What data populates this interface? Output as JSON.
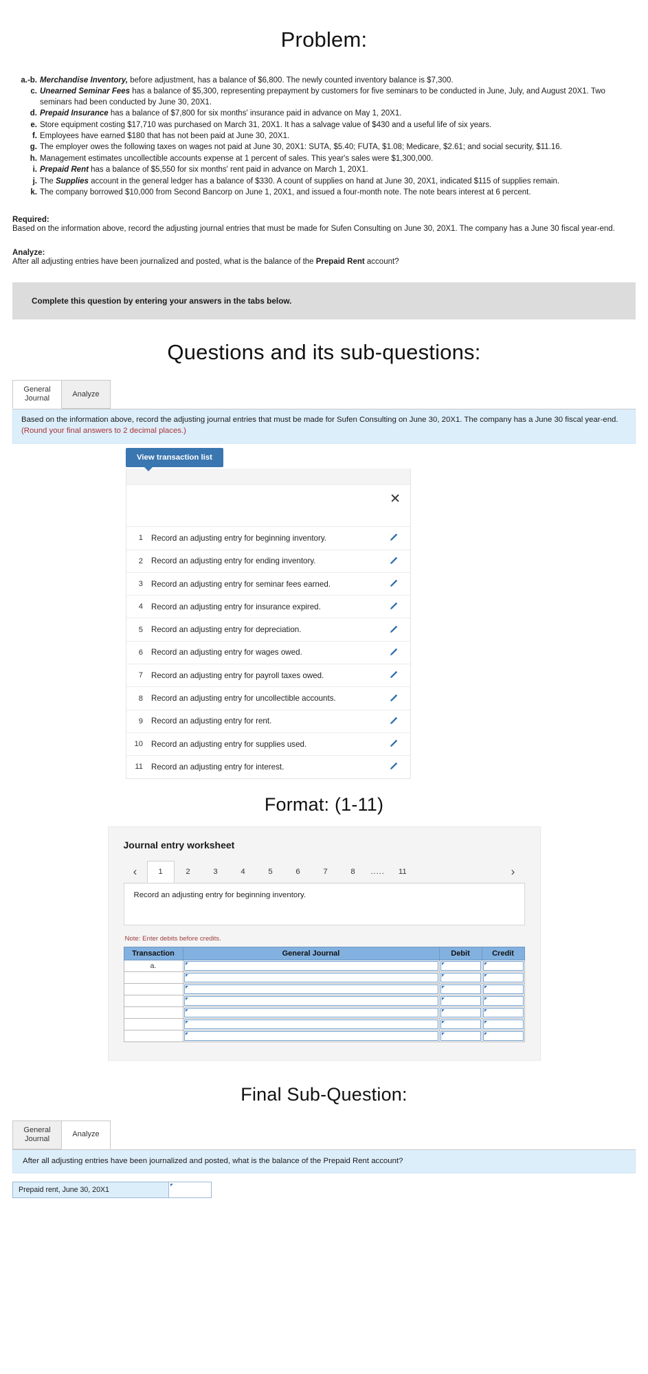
{
  "headings": {
    "problem": "Problem:",
    "questions": "Questions and its sub-questions:",
    "format": "Format:  (1-11)",
    "final": "Final Sub-Question:"
  },
  "problem": {
    "items": [
      {
        "label": "a.-b.",
        "term": "Merchandise Inventory,",
        "text": " before adjustment, has a balance of $6,800. The newly counted inventory balance is $7,300."
      },
      {
        "label": "c.",
        "term": "Unearned Seminar Fees",
        "text": " has a balance of $5,300, representing prepayment by customers for five seminars to be conducted in June, July, and August 20X1. Two seminars had been conducted by June 30, 20X1."
      },
      {
        "label": "d.",
        "term": "Prepaid Insurance",
        "text": " has a balance of $7,800 for six months' insurance paid in advance on May 1, 20X1."
      },
      {
        "label": "e.",
        "term": "",
        "text": "Store equipment costing $17,710 was purchased on March 31, 20X1. It has a salvage value of $430 and a useful life of six years."
      },
      {
        "label": "f.",
        "term": "",
        "text": "Employees have earned $180 that has not been paid at June 30, 20X1."
      },
      {
        "label": "g.",
        "term": "",
        "text": "The employer owes the following taxes on wages not paid at June 30, 20X1: SUTA, $5.40; FUTA, $1.08; Medicare, $2.61; and social security, $11.16."
      },
      {
        "label": "h.",
        "term": "",
        "text": "Management estimates uncollectible accounts expense at 1 percent of sales. This year's sales were $1,300,000."
      },
      {
        "label": "i.",
        "term": "Prepaid Rent",
        "text": " has a balance of $5,550 for six months' rent paid in advance on March 1, 20X1."
      },
      {
        "label": "j.",
        "term": "Supplies",
        "prefix": "The ",
        "text": " account in the general ledger has a balance of $330. A count of supplies on hand at June 30, 20X1, indicated $115 of supplies remain."
      },
      {
        "label": "k.",
        "term": "",
        "text": "The company borrowed $10,000 from Second Bancorp on June 1, 20X1, and issued a four-month note. The note bears interest at 6 percent."
      }
    ],
    "required_title": "Required:",
    "required_text": "Based on the information above, record the adjusting journal entries that must be made for Sufen Consulting on June 30, 20X1. The company has a June 30 fiscal year-end.",
    "analyze_title": "Analyze:",
    "analyze_text_before": "After all adjusting entries have been journalized and posted, what is the balance of the ",
    "analyze_term": "Prepaid Rent",
    "analyze_text_after": " account?",
    "gray_note": "Complete this question by entering your answers in the tabs below."
  },
  "questions_section": {
    "tabs": [
      {
        "label_line1": "General",
        "label_line2": "Journal",
        "active": true
      },
      {
        "label_line1": "Analyze",
        "label_line2": "",
        "active": false
      }
    ],
    "note_text": "Based on the information above, record the adjusting journal entries that must be made for Sufen Consulting on June 30, 20X1. The company has a June 30 fiscal year-end. ",
    "note_round": "(Round your final answers to 2 decimal places.)",
    "view_button": "View transaction list",
    "close_icon": "✕",
    "transactions": [
      {
        "num": "1",
        "text": "Record an adjusting entry for beginning inventory."
      },
      {
        "num": "2",
        "text": "Record an adjusting entry for ending inventory."
      },
      {
        "num": "3",
        "text": "Record an adjusting entry for seminar fees earned."
      },
      {
        "num": "4",
        "text": "Record an adjusting entry for insurance expired."
      },
      {
        "num": "5",
        "text": "Record an adjusting entry for depreciation."
      },
      {
        "num": "6",
        "text": "Record an adjusting entry for wages owed."
      },
      {
        "num": "7",
        "text": "Record an adjusting entry for payroll taxes owed."
      },
      {
        "num": "8",
        "text": "Record an adjusting entry for uncollectible accounts."
      },
      {
        "num": "9",
        "text": "Record an adjusting entry for rent."
      },
      {
        "num": "10",
        "text": "Record an adjusting entry for supplies used."
      },
      {
        "num": "11",
        "text": "Record an adjusting entry for interest."
      }
    ]
  },
  "worksheet": {
    "title": "Journal entry worksheet",
    "prev_icon": "‹",
    "next_icon": "›",
    "page_tabs": [
      "1",
      "2",
      "3",
      "4",
      "5",
      "6",
      "7",
      "8"
    ],
    "dots": ".....",
    "last_tab": "11",
    "active_tab": "1",
    "body_text": "Record an adjusting entry for beginning inventory.",
    "note": "Note: Enter debits before credits.",
    "columns": [
      "Transaction",
      "General Journal",
      "Debit",
      "Credit"
    ],
    "rows": [
      {
        "transaction": "a."
      },
      {
        "transaction": ""
      },
      {
        "transaction": ""
      },
      {
        "transaction": ""
      },
      {
        "transaction": ""
      },
      {
        "transaction": ""
      },
      {
        "transaction": ""
      }
    ]
  },
  "final_section": {
    "tabs": [
      {
        "label_line1": "General",
        "label_line2": "Journal",
        "active": false
      },
      {
        "label_line1": "Analyze",
        "label_line2": "",
        "active": true
      }
    ],
    "question": "After all adjusting entries have been journalized and posted, what is the balance of the Prepaid Rent account?",
    "answer_label": "Prepaid rent, June 30, 20X1",
    "answer_value": ""
  },
  "colors": {
    "accent_blue": "#3a76b0",
    "info_blue": "#ddeefb",
    "table_header_blue": "#82b1e0",
    "note_red": "#9c3b3b",
    "gray_panel": "#dcdcdc"
  }
}
